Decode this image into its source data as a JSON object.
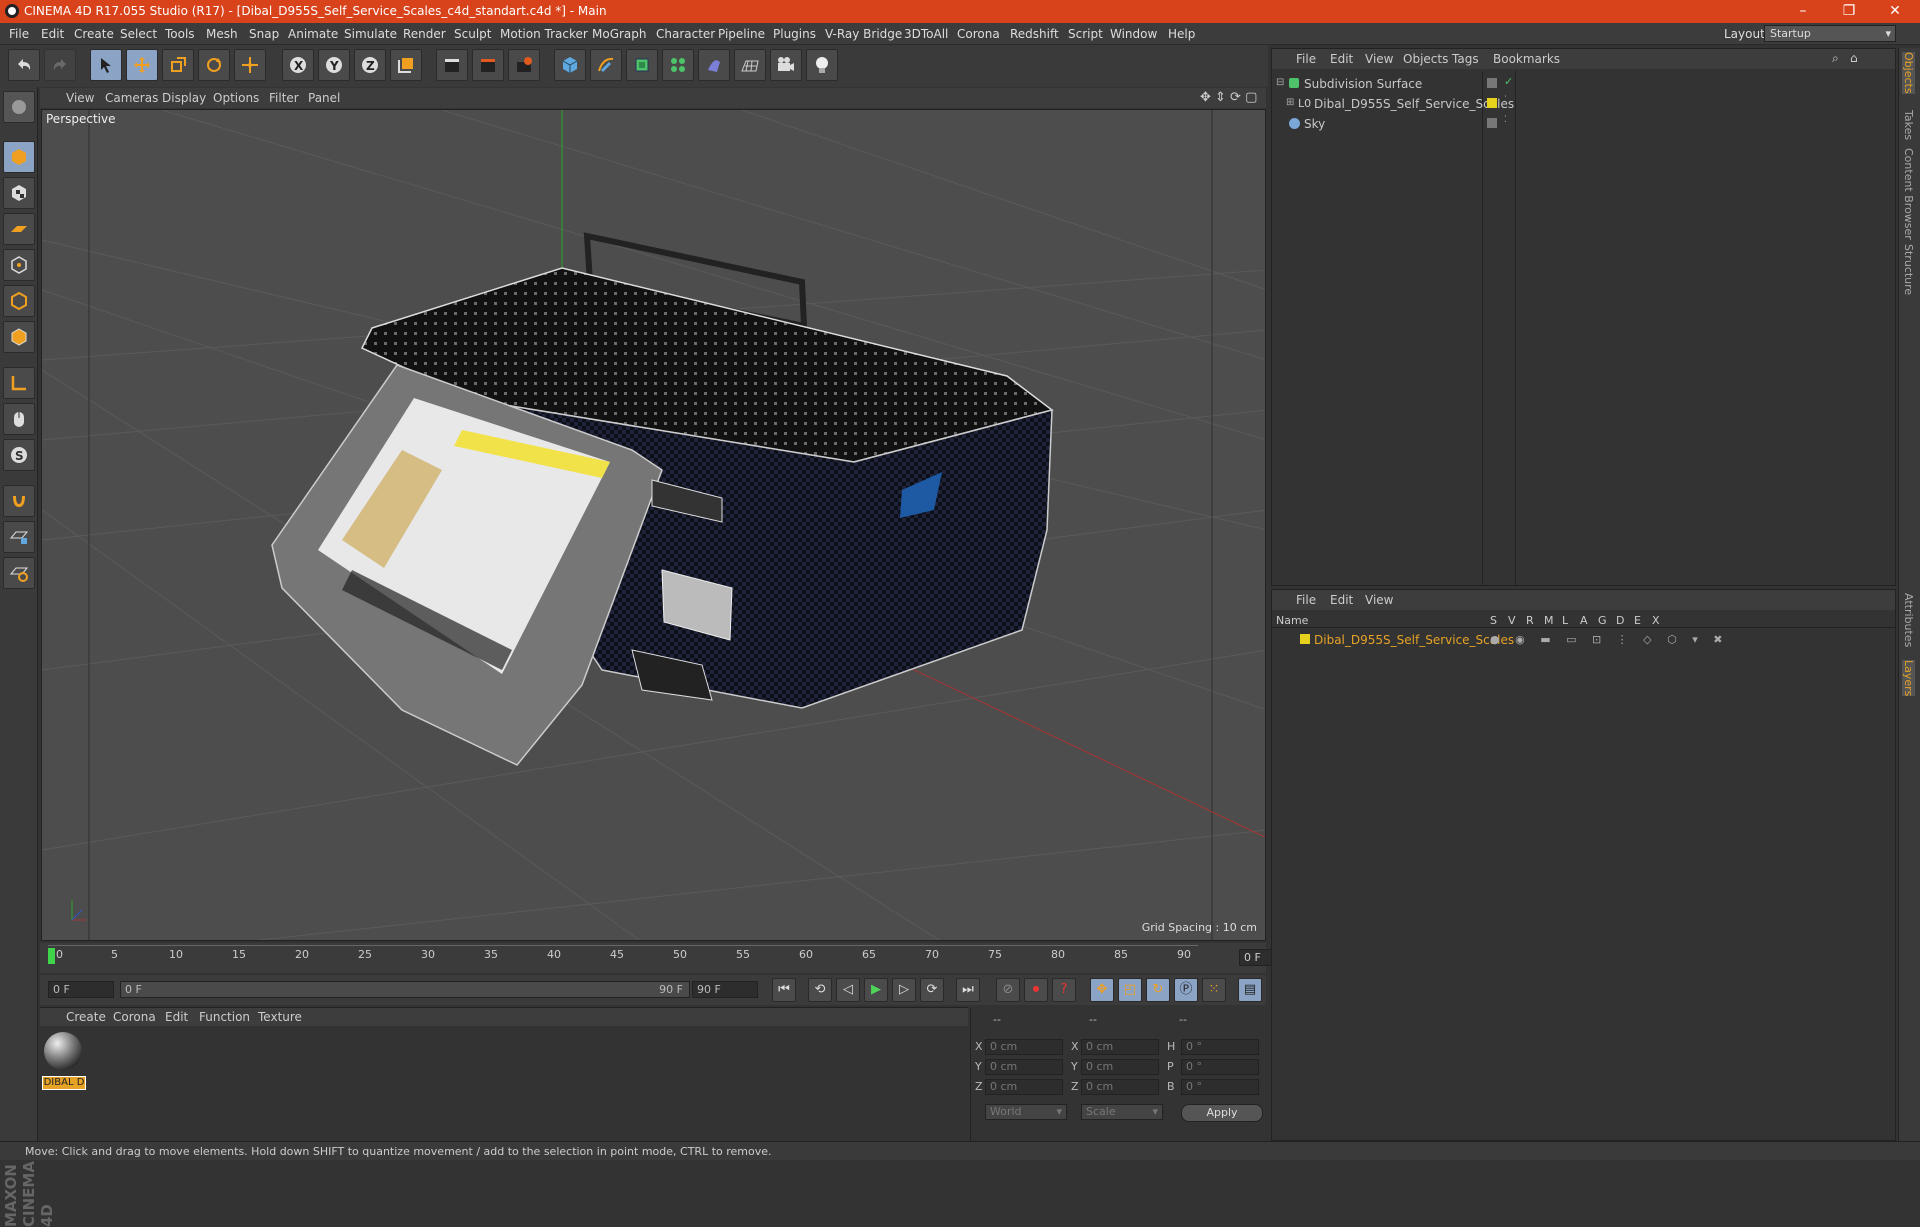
{
  "window": {
    "title": "CINEMA 4D R17.055 Studio (R17) - [Dibal_D955S_Self_Service_Scales_c4d_standart.c4d *] - Main",
    "minimize": "–",
    "maximize": "❐",
    "close": "✕"
  },
  "menubar": {
    "items": [
      "File",
      "Edit",
      "Create",
      "Select",
      "Tools",
      "Mesh",
      "Snap",
      "Animate",
      "Simulate",
      "Render",
      "Sculpt",
      "Motion Tracker",
      "MoGraph",
      "Character",
      "Pipeline",
      "Plugins",
      "V-Ray Bridge",
      "3DToAll",
      "Corona",
      "Redshift",
      "Script",
      "Window",
      "Help"
    ],
    "layout_label": "Layout:",
    "layout_value": "Startup"
  },
  "viewport": {
    "menu": [
      "View",
      "Cameras",
      "Display",
      "Options",
      "Filter",
      "Panel"
    ],
    "label": "Perspective",
    "grid_spacing": "Grid Spacing : 10 cm"
  },
  "timeline": {
    "ticks": [
      "0",
      "5",
      "10",
      "15",
      "20",
      "25",
      "30",
      "35",
      "40",
      "45",
      "50",
      "55",
      "60",
      "65",
      "70",
      "75",
      "80",
      "85",
      "90"
    ],
    "current_frame": "0 F",
    "start": "0 F",
    "range_start": "0 F",
    "range_end": "90 F",
    "end": "90 F"
  },
  "material_manager": {
    "menu": [
      "Create",
      "Corona",
      "Edit",
      "Function",
      "Texture"
    ],
    "material_name": "DIBAL D"
  },
  "coordinates": {
    "headers": [
      "--",
      "--",
      "--"
    ],
    "rows": [
      {
        "a": "X",
        "av": "0 cm",
        "b": "X",
        "bv": "0 cm",
        "c": "H",
        "cv": "0 °"
      },
      {
        "a": "Y",
        "av": "0 cm",
        "b": "Y",
        "bv": "0 cm",
        "c": "P",
        "cv": "0 °"
      },
      {
        "a": "Z",
        "av": "0 cm",
        "b": "Z",
        "bv": "0 cm",
        "c": "B",
        "cv": "0 °"
      }
    ],
    "world": "World",
    "scale": "Scale",
    "apply": "Apply"
  },
  "object_manager": {
    "menu": [
      "File",
      "Edit",
      "View",
      "Objects",
      "Tags",
      "Bookmarks"
    ],
    "objects": [
      "Subdivision Surface",
      "Dibal_D955S_Self_Service_Scales",
      "Sky"
    ]
  },
  "layer_manager": {
    "menu": [
      "File",
      "Edit",
      "View"
    ],
    "col_name": "Name",
    "cols": [
      "S",
      "V",
      "R",
      "M",
      "L",
      "A",
      "G",
      "D",
      "E",
      "X"
    ],
    "layer": "Dibal_D955S_Self_Service_Scales"
  },
  "right_tabs": [
    "Objects",
    "Takes",
    "Content Browser",
    "Structure",
    "Attributes",
    "Layers"
  ],
  "status": "Move: Click and drag to move elements. Hold down SHIFT to quantize movement / add to the selection in point mode, CTRL to remove.",
  "branding": "MAXON CINEMA 4D",
  "colors": {
    "accent": "#d8431c",
    "layer": "#e6a326",
    "selected_tool": "#8ba4c6"
  }
}
